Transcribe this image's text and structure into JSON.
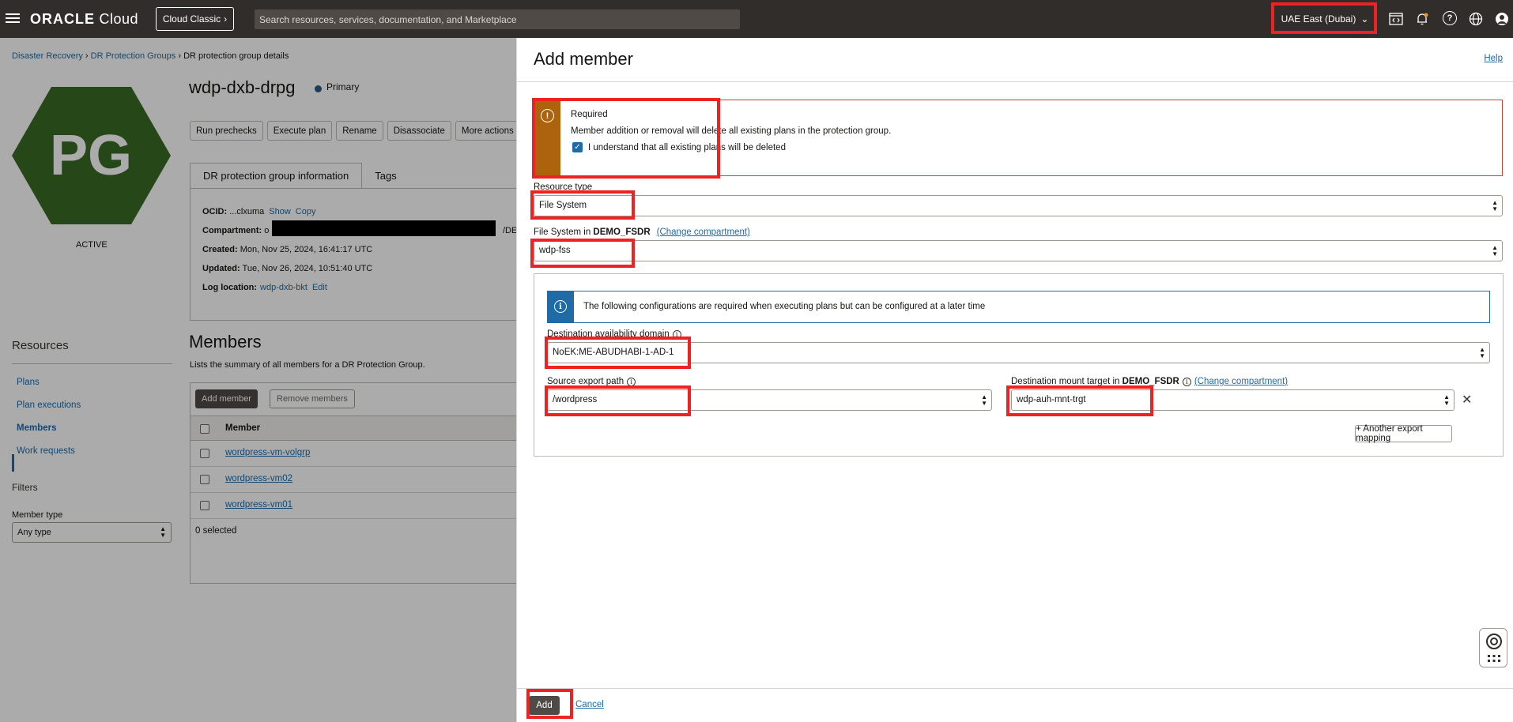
{
  "topbar": {
    "logo_oracle": "ORACLE",
    "logo_cloud": "Cloud",
    "cloud_classic": "Cloud Classic",
    "search_placeholder": "Search resources, services, documentation, and Marketplace",
    "region": "UAE East (Dubai)"
  },
  "breadcrumb": {
    "items": [
      "Disaster Recovery",
      "DR Protection Groups",
      "DR protection group details"
    ],
    "separator": "›"
  },
  "badge": {
    "initials": "PG",
    "status": "ACTIVE",
    "color": "#3a6b25"
  },
  "group": {
    "title": "wdp-dxb-drpg",
    "role": "Primary",
    "actions": [
      "Run prechecks",
      "Execute plan",
      "Rename",
      "Disassociate",
      "More actions"
    ],
    "tabs": [
      "DR protection group information",
      "Tags"
    ],
    "ocid_label": "OCID:",
    "ocid_value": "...clxuma",
    "show": "Show",
    "copy": "Copy",
    "compartment_label": "Compartment:",
    "compartment_prefix": "o",
    "compartment_suffix": "/DEM",
    "created_label": "Created:",
    "created_value": "Mon, Nov 25, 2024, 16:41:17 UTC",
    "updated_label": "Updated:",
    "updated_value": "Tue, Nov 26, 2024, 10:51:40 UTC",
    "log_label": "Log location:",
    "log_value": "wdp-dxb-bkt",
    "edit": "Edit"
  },
  "resources": {
    "title": "Resources",
    "items": [
      "Plans",
      "Plan executions",
      "Members",
      "Work requests"
    ],
    "filters_title": "Filters",
    "member_type_label": "Member type",
    "member_type_value": "Any type"
  },
  "members": {
    "title": "Members",
    "description": "Lists the summary of all members for a DR Protection Group.",
    "add_button": "Add member",
    "remove_button": "Remove members",
    "column": "Member",
    "rows": [
      "wordpress-vm-volgrp",
      "wordpress-vm02",
      "wordpress-vm01"
    ],
    "selected": "0 selected"
  },
  "panel": {
    "title": "Add member",
    "help": "Help",
    "warning_title": "Required",
    "warning_message": "Member addition or removal will delete all existing plans in the protection group.",
    "warning_checkbox": "I understand that all existing plans will be deleted",
    "resource_type_label": "Resource type",
    "resource_type_value": "File System",
    "fs_label": "File System in",
    "fs_compartment": "DEMO_FSDR",
    "change_compartment": "(Change compartment)",
    "fs_value": "wdp-fss",
    "info_banner": "The following configurations are required when executing plans but can be configured at a later time",
    "dest_ad_label": "Destination availability domain",
    "dest_ad_value": "NoEK:ME-ABUDHABI-1-AD-1",
    "source_export_label": "Source export path",
    "source_export_value": "/wordpress",
    "dest_mount_label": "Destination mount target in",
    "dest_mount_compartment": "DEMO_FSDR",
    "dest_mount_value": "wdp-auh-mnt-trgt",
    "another_mapping": "+ Another export mapping",
    "add_button": "Add",
    "cancel": "Cancel"
  }
}
